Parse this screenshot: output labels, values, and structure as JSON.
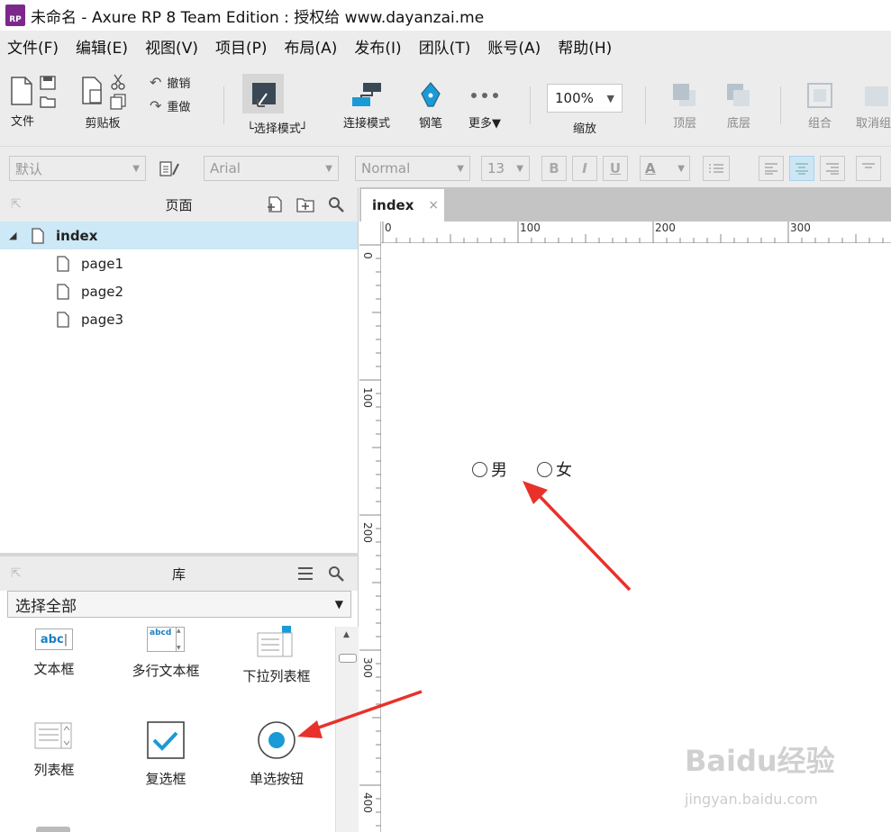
{
  "title": {
    "logo": "RP",
    "text": "未命名 - Axure RP 8 Team Edition : 授权给 www.dayanzai.me"
  },
  "menu": [
    "文件(F)",
    "编辑(E)",
    "视图(V)",
    "项目(P)",
    "布局(A)",
    "发布(I)",
    "团队(T)",
    "账号(A)",
    "帮助(H)"
  ],
  "toolbar": {
    "file": "文件",
    "clipboard": "剪贴板",
    "undo": "撤销",
    "redo": "重做",
    "select_mode": "└选择模式┘",
    "connect_mode": "连接模式",
    "pen": "钢笔",
    "more": "更多▼",
    "zoom_value": "100%",
    "zoom_label": "缩放",
    "top_layer": "顶层",
    "bottom_layer": "底层",
    "group": "组合",
    "ungroup": "取消组"
  },
  "format": {
    "style": "默认",
    "font": "Arial",
    "weight": "Normal",
    "size": "13",
    "bold": "B",
    "italic": "I",
    "underline": "U",
    "font_color": "A"
  },
  "pages_panel": {
    "title": "页面",
    "root": "index",
    "children": [
      "page1",
      "page2",
      "page3"
    ]
  },
  "library_panel": {
    "title": "库",
    "filter": "选择全部",
    "widgets": [
      "文本框",
      "多行文本框",
      "下拉列表框",
      "列表框",
      "复选框",
      "单选按钮"
    ],
    "text_icon": "abc",
    "multiline_icon": "abcd"
  },
  "canvas": {
    "tab_label": "index",
    "tab_close": "×",
    "ruler_x": [
      "0",
      "100",
      "200",
      "300"
    ],
    "ruler_y": [
      "0",
      "100",
      "200",
      "300",
      "400"
    ],
    "radios": [
      "男",
      "女"
    ]
  },
  "watermark": {
    "brand": "Baidu经验",
    "url": "jingyan.baidu.com"
  },
  "colors": {
    "accent": "#1a9ad6",
    "selection": "#cde8f6",
    "arrow": "#e8312a",
    "brand": "#7b2a8c"
  }
}
